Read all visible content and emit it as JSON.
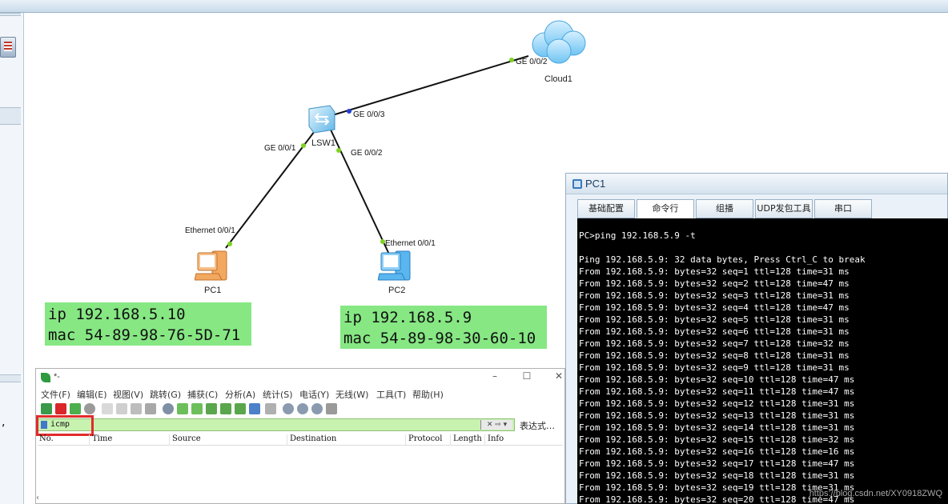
{
  "topology": {
    "devices": [
      {
        "name": "Cloud1"
      },
      {
        "name": "LSW1"
      },
      {
        "name": "PC1"
      },
      {
        "name": "PC2"
      }
    ],
    "ports": {
      "cloud_ge002": "GE 0/0/2",
      "lsw_ge003": "GE 0/0/3",
      "lsw_ge001": "GE 0/0/1",
      "lsw_ge002": "GE 0/0/2",
      "pc1_eth": "Ethernet 0/0/1",
      "pc2_eth": "Ethernet 0/0/1"
    },
    "pc1_info": {
      "ip": "ip 192.168.5.10",
      "mac": "mac 54-89-98-76-5D-71"
    },
    "pc2_info": {
      "ip": "ip 192.168.5.9",
      "mac": "mac 54-89-98-30-60-10"
    },
    "left_panel_comma": ","
  },
  "pc_window": {
    "title": "PC1",
    "tabs": [
      "基础配置",
      "命令行",
      "组播",
      "UDP发包工具",
      "串口"
    ],
    "active_tab": "命令行",
    "command": "PC>ping 192.168.5.9 -t",
    "lines": [
      "Ping 192.168.5.9: 32 data bytes, Press Ctrl_C to break",
      "From 192.168.5.9: bytes=32 seq=1 ttl=128 time=31 ms",
      "From 192.168.5.9: bytes=32 seq=2 ttl=128 time=47 ms",
      "From 192.168.5.9: bytes=32 seq=3 ttl=128 time=31 ms",
      "From 192.168.5.9: bytes=32 seq=4 ttl=128 time=47 ms",
      "From 192.168.5.9: bytes=32 seq=5 ttl=128 time=31 ms",
      "From 192.168.5.9: bytes=32 seq=6 ttl=128 time=31 ms",
      "From 192.168.5.9: bytes=32 seq=7 ttl=128 time=32 ms",
      "From 192.168.5.9: bytes=32 seq=8 ttl=128 time=31 ms",
      "From 192.168.5.9: bytes=32 seq=9 ttl=128 time=31 ms",
      "From 192.168.5.9: bytes=32 seq=10 ttl=128 time=47 ms",
      "From 192.168.5.9: bytes=32 seq=11 ttl=128 time=47 ms",
      "From 192.168.5.9: bytes=32 seq=12 ttl=128 time=31 ms",
      "From 192.168.5.9: bytes=32 seq=13 ttl=128 time=31 ms",
      "From 192.168.5.9: bytes=32 seq=14 ttl=128 time=31 ms",
      "From 192.168.5.9: bytes=32 seq=15 ttl=128 time=32 ms",
      "From 192.168.5.9: bytes=32 seq=16 ttl=128 time=16 ms",
      "From 192.168.5.9: bytes=32 seq=17 ttl=128 time=47 ms",
      "From 192.168.5.9: bytes=32 seq=18 ttl=128 time=31 ms",
      "From 192.168.5.9: bytes=32 seq=19 ttl=128 time=31 ms",
      "From 192.168.5.9: bytes=32 seq=20 ttl=128 time=47 ms"
    ],
    "watermark": "https://blog.csdn.net/XY0918ZWQ"
  },
  "wireshark": {
    "title": "*-",
    "menu": [
      "文件(F)",
      "编辑(E)",
      "视图(V)",
      "跳转(G)",
      "捕获(C)",
      "分析(A)",
      "统计(S)",
      "电话(Y)",
      "无线(W)",
      "工具(T)",
      "帮助(H)"
    ],
    "filter_value": "icmp",
    "expression_label": "表达式…",
    "columns": [
      "No.",
      "Time",
      "Source",
      "Destination",
      "Protocol",
      "Length",
      "Info"
    ],
    "window_controls": {
      "minimize": "–",
      "maximize": "☐",
      "close": "✕"
    },
    "scroll_left": "‹"
  },
  "colors": {
    "info_box": "#86e783",
    "terminal_bg": "#000000",
    "filter_bg": "#c7f2b0",
    "highlight_red": "#e22b2b",
    "link_line": "#111111",
    "port_dot_green": "#7ed321",
    "port_dot_blue": "#1f3fd6"
  }
}
